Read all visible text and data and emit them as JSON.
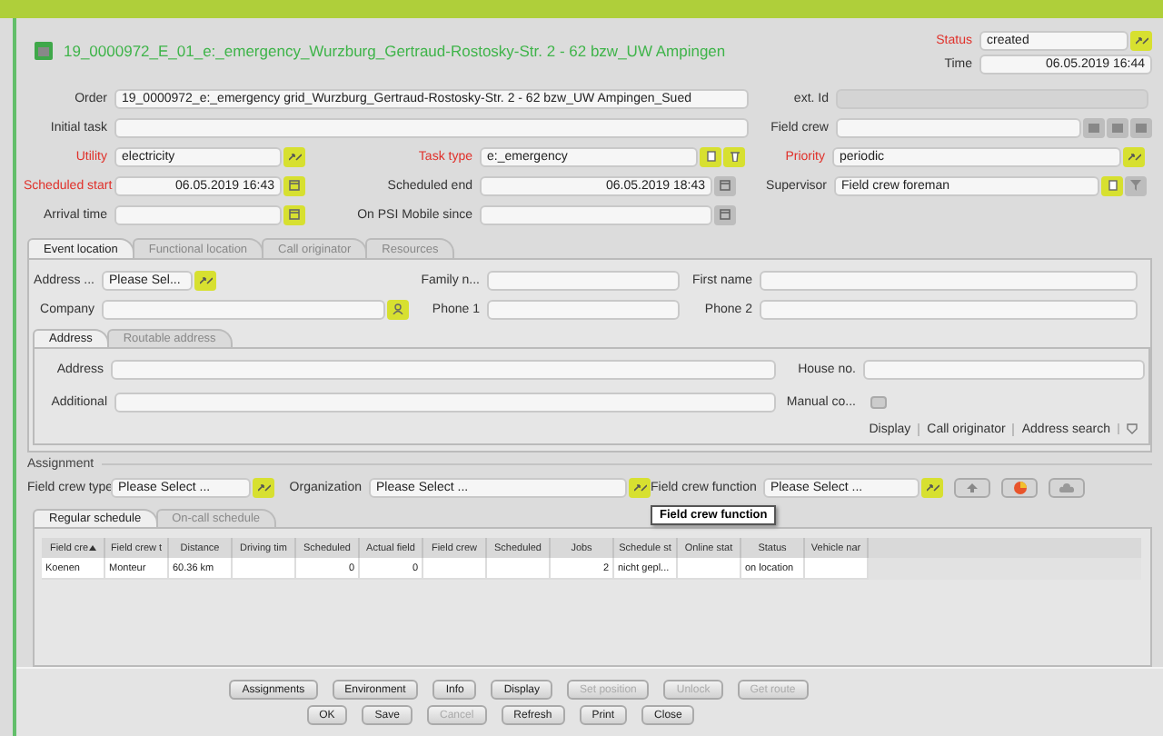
{
  "title": "19_0000972_E_01_e:_emergency_Wurzburg_Gertraud-Rostosky-Str. 2 - 62 bzw_UW Ampingen",
  "status": {
    "label": "Status",
    "value": "created",
    "required": true
  },
  "time": {
    "label": "Time",
    "value": "06.05.2019 16:44"
  },
  "order": {
    "label": "Order",
    "value": "19_0000972_e:_emergency grid_Wurzburg_Gertraud-Rostosky-Str. 2 - 62 bzw_UW Ampingen_Sued"
  },
  "ext_id": {
    "label": "ext. Id",
    "disabled": true
  },
  "initial_task": {
    "label": "Initial task"
  },
  "field_crew": {
    "label": "Field crew"
  },
  "utility": {
    "label": "Utility",
    "value": "electricity",
    "required": true
  },
  "task_type": {
    "label": "Task type",
    "value": "e:_emergency",
    "required": true
  },
  "priority": {
    "label": "Priority",
    "value": "periodic",
    "required": true
  },
  "scheduled_start": {
    "label": "Scheduled start",
    "value": "06.05.2019 16:43",
    "required": true
  },
  "scheduled_end": {
    "label": "Scheduled end",
    "value": "06.05.2019 18:43",
    "required": false
  },
  "supervisor": {
    "label": "Supervisor",
    "value": "Field crew foreman"
  },
  "arrival_time": {
    "label": "Arrival time"
  },
  "psi_mobile": {
    "label": "On PSI Mobile since"
  },
  "location_tabs": [
    {
      "label": "Event location",
      "selected": true
    },
    {
      "label": "Functional location",
      "selected": false
    },
    {
      "label": "Call originator",
      "selected": false
    },
    {
      "label": "Resources",
      "selected": false
    }
  ],
  "location": {
    "address_select": {
      "label": "Address ...",
      "value": "Please Sel..."
    },
    "family_name": {
      "label": "Family n..."
    },
    "first_name": {
      "label": "First name"
    },
    "company": {
      "label": "Company"
    },
    "phone_1": {
      "label": "Phone 1"
    },
    "phone_2": {
      "label": "Phone 2"
    }
  },
  "address_tabs": [
    {
      "label": "Address",
      "selected": true
    },
    {
      "label": "Routable address",
      "selected": false
    }
  ],
  "address": {
    "address": {
      "label": "Address"
    },
    "house_no": {
      "label": "House no."
    },
    "additional": {
      "label": "Additional"
    },
    "manual": {
      "label": "Manual co...",
      "checked": false
    }
  },
  "address_links": [
    "Display",
    "Call originator",
    "Address search"
  ],
  "assignment": {
    "title": "Assignment",
    "field_crew_type": {
      "label": "Field crew type",
      "value": "Please Select ..."
    },
    "organization": {
      "label": "Organization",
      "value": "Please Select ..."
    },
    "field_crew_function": {
      "label": "Field crew function",
      "value": "Please Select ...",
      "tooltip": "Field crew function"
    }
  },
  "schedule_tabs": [
    {
      "label": "Regular schedule",
      "selected": true
    },
    {
      "label": "On-call schedule",
      "selected": false
    }
  ],
  "table": {
    "columns": [
      {
        "label": "Field cre",
        "sorted": true
      },
      {
        "label": "Field crew t"
      },
      {
        "label": "Distance"
      },
      {
        "label": "Driving tim"
      },
      {
        "label": "Scheduled",
        "numeric": true
      },
      {
        "label": "Actual field",
        "numeric": true
      },
      {
        "label": "Field crew"
      },
      {
        "label": "Scheduled"
      },
      {
        "label": "Jobs",
        "numeric": true
      },
      {
        "label": "Schedule st"
      },
      {
        "label": "Online stat"
      },
      {
        "label": "Status"
      },
      {
        "label": "Vehicle nar"
      }
    ],
    "rows": [
      [
        "Koenen",
        "Monteur",
        "60.36 km",
        null,
        "0",
        "0",
        null,
        null,
        "2",
        "nicht gepl...",
        null,
        "on location",
        null
      ]
    ]
  },
  "buttons": [
    [
      {
        "label": "Assignments",
        "disabled": false
      },
      {
        "label": "Environment",
        "disabled": false
      },
      {
        "label": "Info",
        "disabled": false
      },
      {
        "label": "Display",
        "disabled": false
      },
      {
        "label": "Set position",
        "disabled": true
      },
      {
        "label": "Unlock",
        "disabled": true
      },
      {
        "label": "Get route",
        "disabled": true
      }
    ],
    [
      {
        "label": "OK",
        "disabled": false
      },
      {
        "label": "Save",
        "disabled": false
      },
      {
        "label": "Cancel",
        "disabled": true
      },
      {
        "label": "Refresh",
        "disabled": false
      },
      {
        "label": "Print",
        "disabled": false
      },
      {
        "label": "Close",
        "disabled": false
      }
    ]
  ]
}
